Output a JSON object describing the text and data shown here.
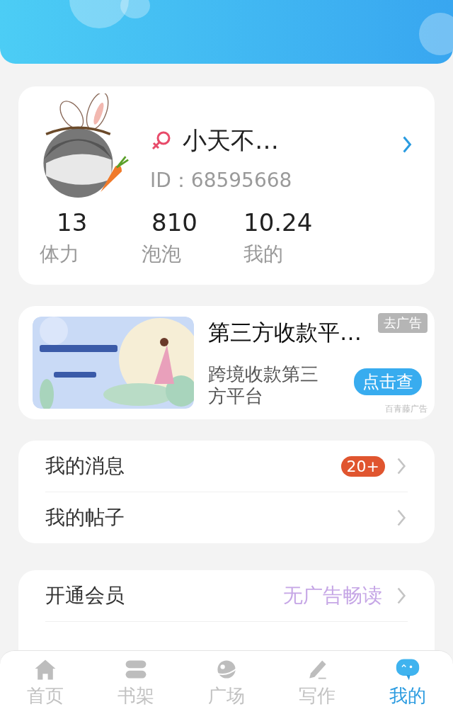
{
  "profile": {
    "name": "小天不…",
    "id_text": "ID：68595668",
    "stats": [
      {
        "value": "13",
        "label": "体力"
      },
      {
        "value": "810",
        "label": "泡泡"
      },
      {
        "value": "10.24",
        "label": "我的"
      }
    ]
  },
  "ad": {
    "kind": "picture",
    "title": "第三方收款平…",
    "close_label": "去广告",
    "description": "跨境收款第三方平台",
    "button": "点击查",
    "source": "百青藤广告"
  },
  "menu_groups": [
    [
      {
        "label": "我的消息",
        "badge": "20+"
      },
      {
        "label": "我的帖子"
      }
    ],
    [
      {
        "label": "开通会员",
        "value": "无广告畅读"
      }
    ]
  ],
  "tabs": [
    {
      "label": "首页",
      "selected": false
    },
    {
      "label": "书架",
      "selected": false
    },
    {
      "label": "广场",
      "selected": false
    },
    {
      "label": "写作",
      "selected": false
    },
    {
      "label": "我的",
      "selected": true
    }
  ]
}
